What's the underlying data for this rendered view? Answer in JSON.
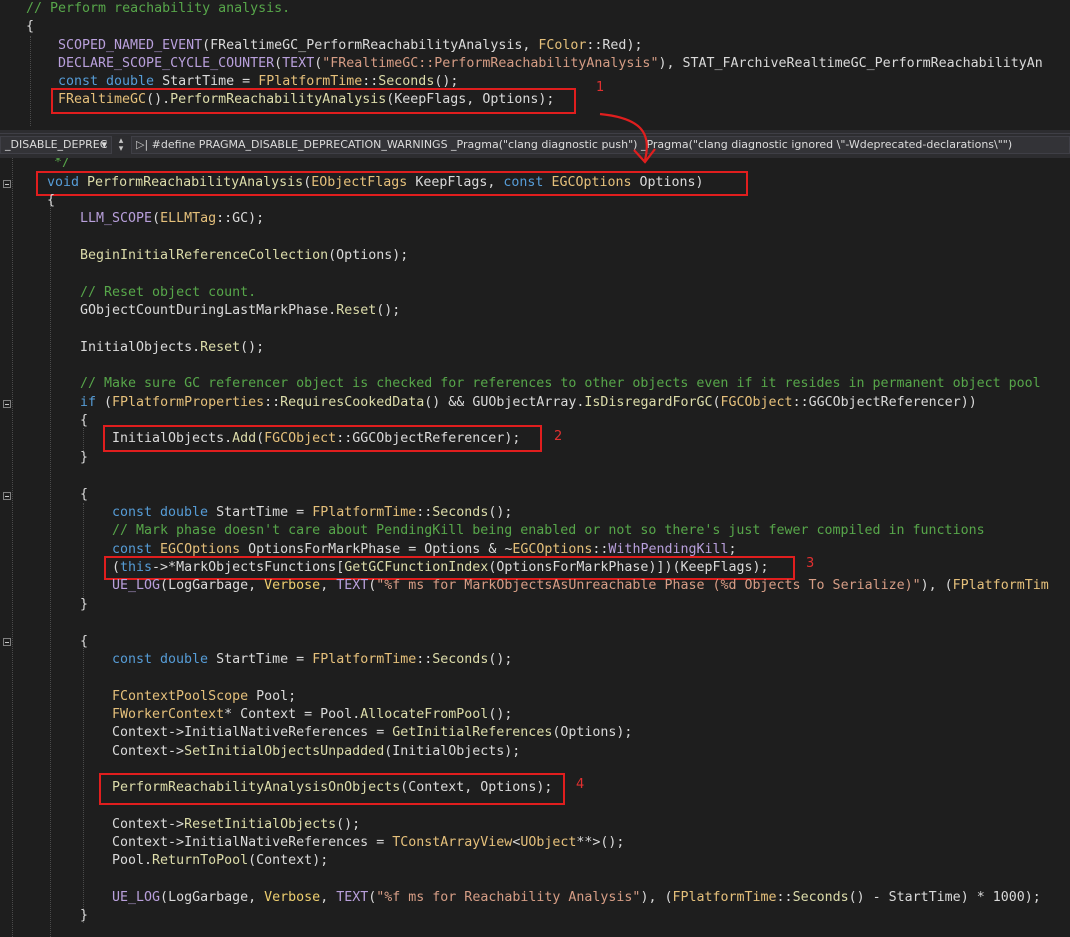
{
  "top_code": {
    "comment": "// Perform reachability analysis.",
    "brace": "{",
    "l1_macro": "SCOPED_NAMED_EVENT",
    "l1_arg": "FRealtimeGC_PerformReachabilityAnalysis",
    "l1_type": "FColor",
    "l1_enum": "Red",
    "l2_macro": "DECLARE_SCOPE_CYCLE_COUNTER",
    "l2_text": "TEXT",
    "l2_str": "\"FRealtimeGC::PerformReachabilityAnalysis\"",
    "l2_stat": "STAT_FArchiveRealtimeGC_PerformReachabilityAn",
    "l3_const": "const double",
    "l3_var": "StartTime",
    "l3_type": "FPlatformTime",
    "l3_fn": "Seconds",
    "l4_type": "FRealtimeGC",
    "l4_fn": "PerformReachabilityAnalysis",
    "l4_args": "(KeepFlags, Options);"
  },
  "nav_bar": {
    "scope_dropdown": "_DISABLE_DEPREC",
    "define_text": "#define PRAGMA_DISABLE_DEPRECATION_WARNINGS _Pragma(\"clang diagnostic push\") _Pragma(\"clang diagnostic ignored \\\"-Wdeprecated-declarations\\\"\")"
  },
  "code": {
    "comment_end": "*/",
    "sig_void": "void",
    "sig_fn": "PerformReachabilityAnalysis",
    "sig_t1": "EObjectFlags",
    "sig_p1": "KeepFlags,",
    "sig_const": "const",
    "sig_t2": "EGCOptions",
    "sig_p2": "Options)",
    "open": "{",
    "llm_fn": "LLM_SCOPE",
    "llm_type": "ELLMTag",
    "llm_val": "GC",
    "begin_fn": "BeginInitialReferenceCollection",
    "begin_args": "(Options);",
    "reset_comment": "// Reset object count.",
    "count_var": "GObjectCountDuringLastMarkPhase",
    "reset_fn": "Reset",
    "initial_var": "InitialObjects",
    "make_comment": "// Make sure GC referencer object is checked for references to other objects even if it resides in permanent object pool",
    "if_kw": "if",
    "props_type": "FPlatformProperties",
    "requires_fn": "RequiresCookedData",
    "guarray": "GUObjectArray",
    "disregard_fn": "IsDisregardForGC",
    "fgc_type": "FGCObject",
    "referencer": "GGCObjectReferencer",
    "add_fn": "Add",
    "const_double": "const double",
    "start_time": "StartTime",
    "ptime": "FPlatformTime",
    "seconds": "Seconds",
    "mark_comment": "// Mark phase doesn't care about PendingKill being enabled or not so there's just fewer compiled in functions",
    "opts_mark": "OptionsForMarkPhase",
    "options": "Options",
    "with_pending": "WithPendingKill",
    "this_kw": "this",
    "mark_fns": "MarkObjectsFunctions",
    "gcindex_fn": "GetGCFunctionIndex",
    "keepflags": "KeepFlags",
    "ue_log": "UE_LOG",
    "log_garbage": "LogGarbage",
    "verbose": "Verbose",
    "text_macro": "TEXT",
    "log_str1": "\"%f ms for MarkObjectsAsUnreachable Phase (%d Objects To Serialize)\"",
    "log_tail1": "FPlatformTim",
    "pool_scope": "FContextPoolScope",
    "pool": "Pool",
    "worker_ctx": "FWorkerContext",
    "context": "Context",
    "alloc_fn": "AllocateFromPool",
    "native_refs": "InitialNativeReferences",
    "get_initial_fn": "GetInitialReferences",
    "set_unpadded_fn": "SetInitialObjectsUnpadded",
    "perf_objects_fn": "PerformReachabilityAnalysisOnObjects",
    "reset_initial_fn": "ResetInitialObjects",
    "array_view": "TConstArrayView",
    "uobject": "UObject",
    "return_fn": "ReturnToPool",
    "log_str2": "\"%f ms for Reachability Analysis\"",
    "close": "}"
  },
  "annotations": {
    "n1": "1",
    "n2": "2",
    "n3": "3",
    "n4": "4"
  },
  "colors": {
    "highlight": "#e01e1e",
    "background": "#1e1e1e"
  }
}
